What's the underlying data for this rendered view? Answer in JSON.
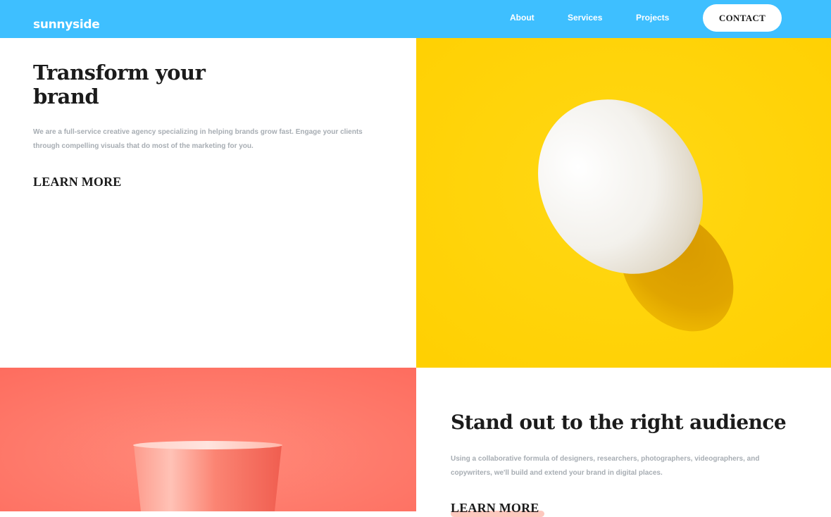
{
  "header": {
    "logo": "sunnyside",
    "nav": {
      "about": "About",
      "services": "Services",
      "projects": "Projects"
    },
    "contact_label": "CONTACT",
    "background_color": "#3ebfff"
  },
  "hero": {
    "title": "Transform your brand",
    "body": "We are a full-service creative agency specializing in helping brands grow fast. Engage your clients through compelling visuals that do most of the marketing for you.",
    "learn_more": "LEARN MORE",
    "accent_color": "#fdec9e",
    "image": "egg-on-yellow-image",
    "image_background": "#ffd204"
  },
  "feature": {
    "title": "Stand out to the right audience",
    "body": "Using a collaborative formula of designers, researchers, photographers, videographers, and copywriters, we'll build and extend your brand in digital places.",
    "learn_more": "LEARN MORE",
    "accent_color": "#fdc8be",
    "image": "pink-cup-image",
    "image_background": "#fe7b6b"
  }
}
